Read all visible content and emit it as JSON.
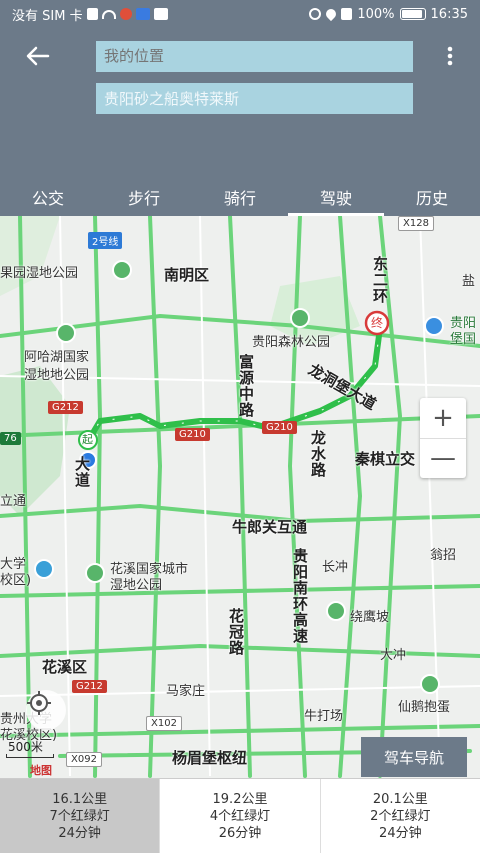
{
  "status_bar": {
    "carrier": "没有 SIM 卡",
    "battery": "100%",
    "time": "16:35"
  },
  "search": {
    "start_placeholder": "我的位置",
    "end_value": "贵阳砂之船奥特莱斯"
  },
  "tabs": [
    {
      "label": "公交"
    },
    {
      "label": "步行"
    },
    {
      "label": "骑行"
    },
    {
      "label": "驾驶"
    },
    {
      "label": "历史"
    }
  ],
  "active_tab": "驾驶",
  "map": {
    "labels": {
      "nanming": "南明区",
      "guoyuan": "果园湿地公园",
      "senlin": "贵阳森林公园",
      "aha": "阿哈湖国家",
      "aha2": "湿地地公园",
      "fuyuan": "富源中路",
      "longdong": "龙洞堡大道",
      "longshui": "龙水路",
      "dongerhuan": "东二环",
      "qinqi": "秦棋立交",
      "guiyang_airport": "贵阳",
      "guiyang_airport2": "堡国",
      "niulangguan": "牛郎关互通",
      "huaxi_park": "花溪国家城市",
      "huaxi_park2": "湿地公园",
      "huaxi_dist": "花溪区",
      "huaguan": "花冠路",
      "nanhuan": "贵阳南环高速",
      "changchong": "长冲",
      "raoying": "绕鹰坡",
      "wengzhao": "翁招",
      "dachong": "大冲",
      "xian": "仙鹅抱蛋",
      "majiazhuang": "马家庄",
      "niudachang": "牛打场",
      "yangmei": "杨眉堡枢纽",
      "daxue": "大学",
      "daxue2": "校区)",
      "gui_university": "贵州大学",
      "huaxi_campus": "花溪校区)",
      "li": "立通",
      "hutong": "互通",
      "erhao": "2号线",
      "da_dao": "大道",
      "yan": "盐",
      "da_right": "大"
    },
    "shields": {
      "g212_a": "G212",
      "g210_a": "G210",
      "g210_b": "G210",
      "g212_b": "G212",
      "x128": "X128",
      "x102": "X102",
      "x092": "X092",
      "n76": "76"
    },
    "markers": {
      "start": "起",
      "end": "终"
    },
    "zoom_in": "+",
    "zoom_out": "—",
    "scale": "500米",
    "logo": "地图"
  },
  "nav_button": "驾车导航",
  "routes": [
    {
      "distance": "16.1公里",
      "lights": "7个红绿灯",
      "duration": "24分钟"
    },
    {
      "distance": "19.2公里",
      "lights": "4个红绿灯",
      "duration": "26分钟"
    },
    {
      "distance": "20.1公里",
      "lights": "2个红绿灯",
      "duration": "24分钟"
    }
  ],
  "colors": {
    "header": "#6c7a89",
    "field": "#a9d3e0",
    "route_green": "#2fbf4a",
    "road_green": "#6bd47a"
  }
}
